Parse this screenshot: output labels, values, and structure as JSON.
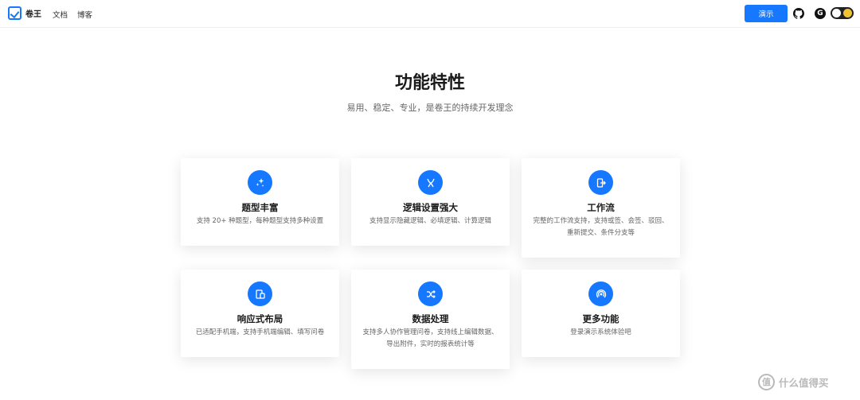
{
  "header": {
    "brand": "卷王",
    "nav": [
      "文档",
      "博客"
    ],
    "demo_button": "演示",
    "github_icon": "github-icon",
    "gitee_icon": "gitee-icon",
    "gitee_glyph": "G",
    "theme_toggle": "theme-toggle"
  },
  "hero": {
    "title": "功能特性",
    "subtitle": "易用、稳定、专业，是卷王的持续开发理念"
  },
  "features": [
    {
      "icon": "sparkles-icon",
      "title": "题型丰富",
      "desc": "支持 20+ 种题型，每种题型支持多种设置"
    },
    {
      "icon": "logic-branch-icon",
      "title": "逻辑设置强大",
      "desc": "支持显示隐藏逻辑、必填逻辑、计算逻辑"
    },
    {
      "icon": "workflow-exit-icon",
      "title": "工作流",
      "desc": "完整的工作流支持，支持或签、会签、驳回、重新提交、条件分支等"
    },
    {
      "icon": "responsive-devices-icon",
      "title": "响应式布局",
      "desc": "已适配手机端，支持手机端编辑、填写问卷"
    },
    {
      "icon": "shuffle-icon",
      "title": "数据处理",
      "desc": "支持多人协作管理问卷，支持线上编辑数据、导出附件，实时的报表统计等"
    },
    {
      "icon": "broadcast-icon",
      "title": "更多功能",
      "desc": "登录演示系统体验吧"
    }
  ],
  "watermark": {
    "badge": "值",
    "text": "什么值得买"
  },
  "colors": {
    "accent": "#1677ff",
    "text_primary": "#1a1a1a",
    "text_secondary": "#666666"
  }
}
